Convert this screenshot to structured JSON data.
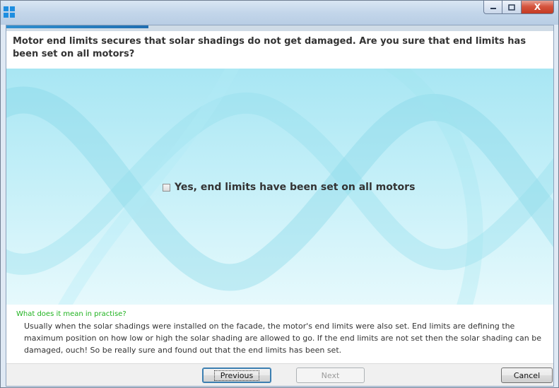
{
  "window": {
    "app_icon": "windows-tile-icon",
    "controls": {
      "minimize": "minimize-icon",
      "maximize": "maximize-icon",
      "close_label": "X"
    }
  },
  "wizard": {
    "progress": 0.26,
    "question": "Motor end limits secures that solar shadings do not get damaged. Are you sure that end limits has been set on all motors?",
    "confirm_label": "Yes, end limits have been set on all motors",
    "confirm_checked": false,
    "help_title": "What does it mean in practise?",
    "help_text": "Usually when the solar shadings were installed on the facade, the motor's end limits were also set. End limits are defining the maximum position on how low or high the solar shading are allowed to go. If the end limits are not set then the solar shading can be damaged, ouch! So be really sure and found out that the end limits has been set."
  },
  "buttons": {
    "previous": "Previous",
    "next": "Next",
    "cancel": "Cancel"
  },
  "colors": {
    "accent": "#1f6eb1",
    "help_title": "#21b321",
    "hero": "#a8e6f3"
  }
}
